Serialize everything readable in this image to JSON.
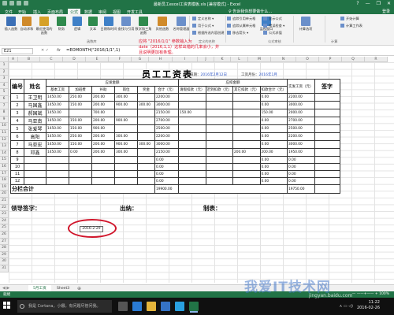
{
  "window": {
    "title": "最新员工excel工资表模板.xls [兼容模式] - Excel",
    "buttons": [
      "?",
      "—",
      "❐",
      "✕"
    ]
  },
  "menu": {
    "tabs": [
      "文件",
      "开始",
      "插入",
      "页面布局",
      "公式",
      "数据",
      "审阅",
      "视图",
      "开发工具"
    ],
    "active_index": 4,
    "tell_me": "♀ 告诉我你想要做什么…",
    "login": "登录"
  },
  "ribbon": {
    "large_buttons": [
      {
        "label": "插入函数",
        "icon": "fx-icon",
        "color": "#3b6fb6"
      },
      {
        "label": "自动求和",
        "icon": "sigma-icon",
        "color": "#d08a2a"
      },
      {
        "label": "最近使用的函数",
        "icon": "star-icon",
        "color": "#d6a128"
      },
      {
        "label": "财务",
        "icon": "book-icon",
        "color": "#2f8a4d"
      },
      {
        "label": "逻辑",
        "icon": "question-icon",
        "color": "#3f80c7"
      },
      {
        "label": "文本",
        "icon": "text-icon",
        "color": "#2f8a4d"
      },
      {
        "label": "日期和时间",
        "icon": "clock-icon",
        "color": "#3f80c7"
      },
      {
        "label": "查找与引用",
        "icon": "search-icon",
        "color": "#6a8fca"
      },
      {
        "label": "数学和三角函数",
        "icon": "theta-icon",
        "color": "#2f8a4d"
      },
      {
        "label": "其他函数",
        "icon": "more-icon",
        "color": "#d08a2a"
      },
      {
        "label": "名称管理器",
        "icon": "tag-icon",
        "color": "#6a8fca"
      },
      {
        "label": "监视窗口",
        "icon": "watch-icon",
        "color": "#3f80c7"
      },
      {
        "label": "计算选项",
        "icon": "calc-icon",
        "color": "#6a8fca"
      }
    ],
    "small_buttons": [
      {
        "label": "定义名称 ▾",
        "icon": "define-name-icon"
      },
      {
        "label": "用于公式 ▾",
        "icon": "use-formula-icon"
      },
      {
        "label": "根据所选内容创建",
        "icon": "create-selection-icon"
      },
      {
        "label": "追踪引用单元格",
        "icon": "trace-precedents-icon"
      },
      {
        "label": "追踪从属单元格",
        "icon": "trace-dependents-icon"
      },
      {
        "label": "移去箭头 ▾",
        "icon": "remove-arrows-icon"
      },
      {
        "label": "显示公式",
        "icon": "show-formula-icon"
      },
      {
        "label": "错误检查 ▾",
        "icon": "error-check-icon"
      },
      {
        "label": "公式求值",
        "icon": "evaluate-icon"
      },
      {
        "label": "开始计算",
        "icon": "calc-now-icon"
      },
      {
        "label": "计算工作表",
        "icon": "calc-sheet-icon"
      }
    ],
    "groups": [
      "函数库",
      "定义的名称",
      "公式审核",
      "计算"
    ]
  },
  "formula_bar": {
    "name_box": "E21",
    "fx_label": "fx",
    "formula": "=EOMONTH(\"2016/1/1\",1)"
  },
  "annotation": {
    "lines": [
      "应将 \"2016/1/1\" 参数输入为",
      "date（2016,1,1）这样出错的几率会小，并",
      "且说明更加有条理。"
    ]
  },
  "grid": {
    "columns": [
      "A",
      "B",
      "C",
      "D",
      "E",
      "F",
      "G",
      "H",
      "I",
      "J",
      "K",
      "L",
      "M",
      "N",
      "O",
      "P",
      "Q",
      "R"
    ],
    "rows": [
      "1",
      "2",
      "3",
      "4",
      "5",
      "6",
      "7",
      "8",
      "9",
      "10",
      "11",
      "12",
      "13",
      "14",
      "15",
      "16",
      "17",
      "18",
      "19",
      "20",
      "21",
      "22",
      "23",
      "24",
      "25",
      "26",
      "27",
      "28",
      "29",
      "30",
      "31"
    ]
  },
  "sheet": {
    "title": "员工工资表",
    "fill_date_label": "填表日期：",
    "fill_date_value": "2016年2月12日",
    "pay_month_label": "工资月份：",
    "pay_month_value": "2016年1月",
    "headers": {
      "no": "编号",
      "name": "姓名",
      "payable_group": "应发金额",
      "deduction_group": "应扣金额",
      "base_salary": "基本工资",
      "overtime": "加班费",
      "subsidy": "补助",
      "position": "岗位",
      "bonus": "奖金",
      "subtotal": "合计（元）",
      "leave_deduction": "请假扣款（元）",
      "late_deduction": "迟到扣款（元）",
      "other_deduction": "其它扣款（元）",
      "deduction_total": "扣款合计（元）",
      "actual_pay": "实发工资（元）",
      "sign": "签字"
    },
    "rows": [
      {
        "no": "1",
        "name": "王卫明",
        "base": "1450.00",
        "overtime": "250.00",
        "subsidy": "200.00",
        "position": "300.00",
        "bonus": "",
        "total": "2200.00",
        "leave": "",
        "late": "",
        "other": "",
        "ded_total": "0.00",
        "actual": "2200.00"
      },
      {
        "no": "2",
        "name": "马国鑫",
        "base": "1450.00",
        "overtime": "150.00",
        "subsidy": "200.00",
        "position": "900.00",
        "bonus": "300.00",
        "total": "3000.00",
        "leave": "",
        "late": "",
        "other": "",
        "ded_total": "0.00",
        "actual": "3000.00"
      },
      {
        "no": "3",
        "name": "郝国斌",
        "base": "1450.00",
        "overtime": "",
        "subsidy": "700.00",
        "position": "",
        "bonus": "",
        "total": "2150.00",
        "leave": "150.00",
        "late": "",
        "other": "",
        "ded_total": "150.00",
        "actual": "2000.00"
      },
      {
        "no": "4",
        "name": "马亚南",
        "base": "1450.00",
        "overtime": "150.00",
        "subsidy": "200.00",
        "position": "900.00",
        "bonus": "",
        "total": "2700.00",
        "leave": "",
        "late": "",
        "other": "",
        "ded_total": "0.00",
        "actual": "2700.00"
      },
      {
        "no": "5",
        "name": "张爱琴",
        "base": "1450.00",
        "overtime": "150.00",
        "subsidy": "900.00",
        "position": "",
        "bonus": "",
        "total": "2500.00",
        "leave": "",
        "late": "",
        "other": "",
        "ded_total": "0.00",
        "actual": "2500.00"
      },
      {
        "no": "6",
        "name": "高阳",
        "base": "1450.00",
        "overtime": "250.00",
        "subsidy": "200.00",
        "position": "300.00",
        "bonus": "",
        "total": "2200.00",
        "leave": "",
        "late": "",
        "other": "",
        "ded_total": "0.00",
        "actual": "2200.00"
      },
      {
        "no": "7",
        "name": "马亚宏",
        "base": "1450.00",
        "overtime": "150.00",
        "subsidy": "200.00",
        "position": "900.00",
        "bonus": "300.00",
        "total": "3000.00",
        "leave": "",
        "late": "",
        "other": "",
        "ded_total": "0.00",
        "actual": "3000.00"
      },
      {
        "no": "8",
        "name": "邓鑫",
        "base": "1450.00",
        "overtime": "0.00",
        "subsidy": "200.00",
        "position": "300.00",
        "bonus": "",
        "total": "2150.00",
        "leave": "",
        "late": "",
        "other": "200.00",
        "ded_total": "200.00",
        "actual": "1950.00"
      },
      {
        "no": "9",
        "name": "",
        "base": "",
        "overtime": "",
        "subsidy": "",
        "position": "",
        "bonus": "",
        "total": "0.00",
        "leave": "",
        "late": "",
        "other": "",
        "ded_total": "0.00",
        "actual": "0.00"
      },
      {
        "no": "10",
        "name": "",
        "base": "",
        "overtime": "",
        "subsidy": "",
        "position": "",
        "bonus": "",
        "total": "0.00",
        "leave": "",
        "late": "",
        "other": "",
        "ded_total": "0.00",
        "actual": "0.00"
      },
      {
        "no": "11",
        "name": "",
        "base": "",
        "overtime": "",
        "subsidy": "",
        "position": "",
        "bonus": "",
        "total": "0.00",
        "leave": "",
        "late": "",
        "other": "",
        "ded_total": "0.00",
        "actual": "0.00"
      },
      {
        "no": "12",
        "name": "",
        "base": "",
        "overtime": "",
        "subsidy": "",
        "position": "",
        "bonus": "",
        "total": "0.00",
        "leave": "",
        "late": "",
        "other": "",
        "ded_total": "0.00",
        "actual": "0.00"
      }
    ],
    "total_label": "分栏合计",
    "grand_total": "19900.00",
    "grand_actual": "19750.00",
    "leader_sign": "领导签字：",
    "cashier": "出纳：",
    "preparer": "制表：",
    "date_cell": "2016-2-29"
  },
  "sheet_tabs": {
    "nav": "◀ ▶",
    "tabs": [
      "5月工资",
      "Sheet3"
    ],
    "active_index": 0,
    "add": "⊕"
  },
  "statusbar": {
    "ready": "就绪",
    "zoom": "— ——+—— +  100%"
  },
  "taskbar": {
    "search_placeholder": "我是 Cortana，小娜。有问题尽管问我。",
    "tray": "∧ ▭ ◁)",
    "time": "11:22",
    "date": "2016-02-26",
    "app_icons": [
      {
        "name": "task-view-icon",
        "color": "#555555"
      },
      {
        "name": "edge-icon",
        "color": "#2a7bd4"
      },
      {
        "name": "explorer-icon",
        "color": "#e4b43b"
      },
      {
        "name": "store-icon",
        "color": "#3573c6"
      },
      {
        "name": "browser-icon",
        "color": "#29a0e0"
      },
      {
        "name": "excel-icon",
        "color": "#217346"
      }
    ]
  },
  "watermark": {
    "text": "我爱IT技术网",
    "url": "jingyan.baidu.com"
  },
  "colors": {
    "excel_green": "#217346",
    "annotation_red": "#e0142e",
    "date_blue": "#2f57c9"
  }
}
